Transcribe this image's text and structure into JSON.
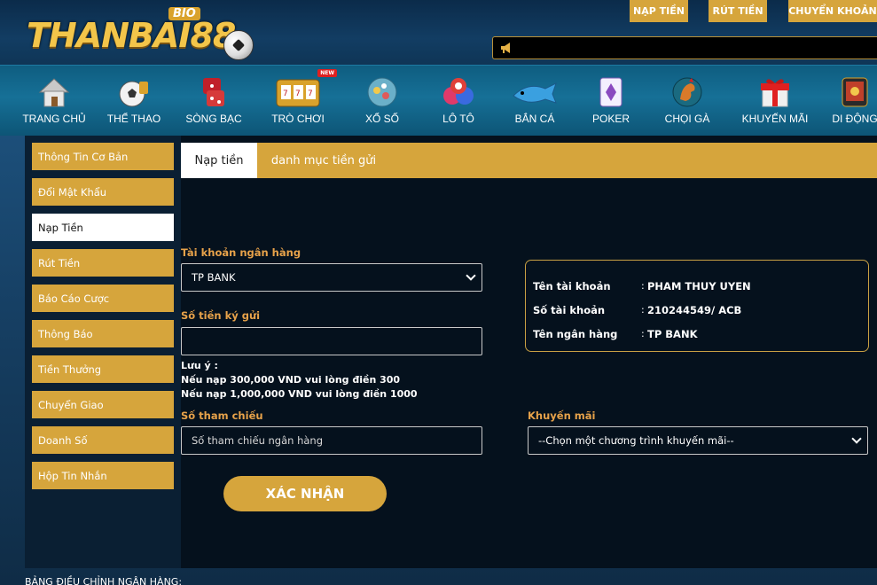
{
  "header": {
    "logo_text": "THANBAI88",
    "logo_badge": "BIO",
    "top_buttons": [
      "NẠP TIỀN",
      "RÚT TIỀN",
      "CHUYỂN KHOẢN"
    ]
  },
  "nav": [
    {
      "label": "TRANG CHỦ",
      "icon": "house-icon"
    },
    {
      "label": "THỂ THAO",
      "icon": "sports-ball-icon"
    },
    {
      "label": "SÒNG BẠC",
      "icon": "dice-icon"
    },
    {
      "label": "TRÒ CHƠI",
      "icon": "slot-machine-icon",
      "badge": "NEW"
    },
    {
      "label": "XỔ SỐ",
      "icon": "lottery-icon"
    },
    {
      "label": "LÔ TÔ",
      "icon": "lotto-balls-icon"
    },
    {
      "label": "BẮN CÁ",
      "icon": "shark-icon"
    },
    {
      "label": "POKER",
      "icon": "poker-card-icon"
    },
    {
      "label": "CHỌI GÀ",
      "icon": "rooster-icon"
    },
    {
      "label": "KHUYẾN MÃI",
      "icon": "gift-icon"
    },
    {
      "label": "DI ĐỘNG",
      "icon": "mobile-icon"
    }
  ],
  "sidebar": [
    {
      "label": "Thông Tin Cơ Bản"
    },
    {
      "label": "Đổi Mật Khẩu"
    },
    {
      "label": "Nạp Tiền",
      "active": true
    },
    {
      "label": "Rút Tiền"
    },
    {
      "label": "Báo Cáo Cược"
    },
    {
      "label": "Thông Báo"
    },
    {
      "label": "Tiền Thưởng"
    },
    {
      "label": "Chuyển Giao"
    },
    {
      "label": "Doanh Số"
    },
    {
      "label": "Hộp Tin Nhắn"
    }
  ],
  "tabs": {
    "active": "Nạp tiền",
    "other": "danh mục tiền gửi"
  },
  "form": {
    "bank_label": "Tài khoản ngân hàng",
    "bank_value": "TP BANK",
    "amount_label": "Số tiền ký gửi",
    "amount_value": "",
    "note_title": "Lưu ý :",
    "note_line1": "Nếu nạp 300,000 VND vui lòng điền 300",
    "note_line2": "Nếu nạp 1,000,000 VND vui lòng điền 1000",
    "ref_label": "Số tham chiếu",
    "ref_placeholder": "Số tham chiếu ngân hàng",
    "promo_label": "Khuyến mãi",
    "promo_value": "--Chọn một chương trình khuyến mãi--",
    "confirm_label": "XÁC NHẬN"
  },
  "account_info": {
    "name_label": "Tên tài khoản",
    "name_value": "PHAM THUY UYEN",
    "number_label": "Số tài khoản",
    "number_value": "210244549/ ACB",
    "bank_label": "Tên ngân hàng",
    "bank_value": "TP BANK",
    "colon": ":"
  },
  "footer": {
    "text": "BẢNG ĐIỀU CHỈNH NGÂN HÀNG:"
  },
  "colors": {
    "gold": "#d6a53c",
    "label_orange": "#e7a24a",
    "panel_dark": "#05111d",
    "nav_teal": "#167097"
  }
}
